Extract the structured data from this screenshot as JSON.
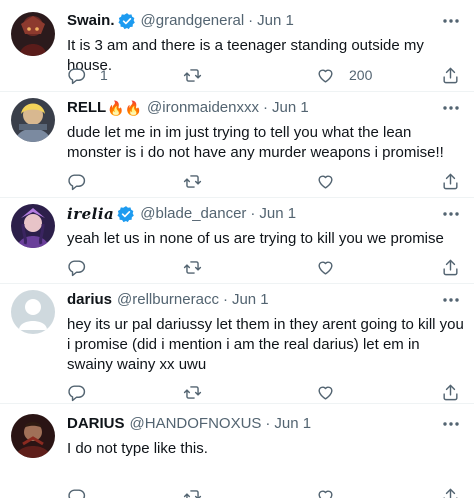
{
  "tweets": [
    {
      "display_name": "Swain.",
      "handle": "@grandgeneral",
      "separator": "·",
      "date": "Jun 1",
      "verified": true,
      "text": "It is 3 am and there is a teenager standing outside my house.",
      "reply_count": "1",
      "retweet_count": "",
      "like_count": "200"
    },
    {
      "display_name": "RELL",
      "name_emoji": "🔥🔥",
      "handle": "@ironmaidenxxx",
      "separator": "·",
      "date": "Jun 1",
      "text": "dude let me in im just trying to tell you what the lean monster is i do not have any murder weapons i promise!!",
      "reply_count": "",
      "retweet_count": "",
      "like_count": ""
    },
    {
      "display_name": "irelia",
      "handle": "@blade_dancer",
      "separator": "·",
      "date": "Jun 1",
      "verified": true,
      "text": "yeah let us in none of us are trying to kill you we promise",
      "reply_count": "",
      "retweet_count": "",
      "like_count": ""
    },
    {
      "display_name": "darius",
      "handle": "@rellburneracc",
      "separator": "·",
      "date": "Jun 1",
      "text": "hey its ur pal dariussy let them in they arent going to kill you i promise (did i mention i am the real darius) let em in swainy wainy xx uwu",
      "reply_count": "",
      "retweet_count": "",
      "like_count": ""
    },
    {
      "display_name": "DARIUS",
      "handle": "@HANDOFNOXUS",
      "separator": "·",
      "date": "Jun 1",
      "text": "I do not type like this.",
      "reply_count": "",
      "retweet_count": "",
      "like_count": ""
    }
  ],
  "colors": {
    "text": "#0f1419",
    "muted": "#536471",
    "verified": "#1d9bf0",
    "divider": "#eff3f4"
  },
  "icons": [
    "more-icon",
    "reply-icon",
    "retweet-icon",
    "like-icon",
    "share-icon",
    "verified-icon"
  ]
}
